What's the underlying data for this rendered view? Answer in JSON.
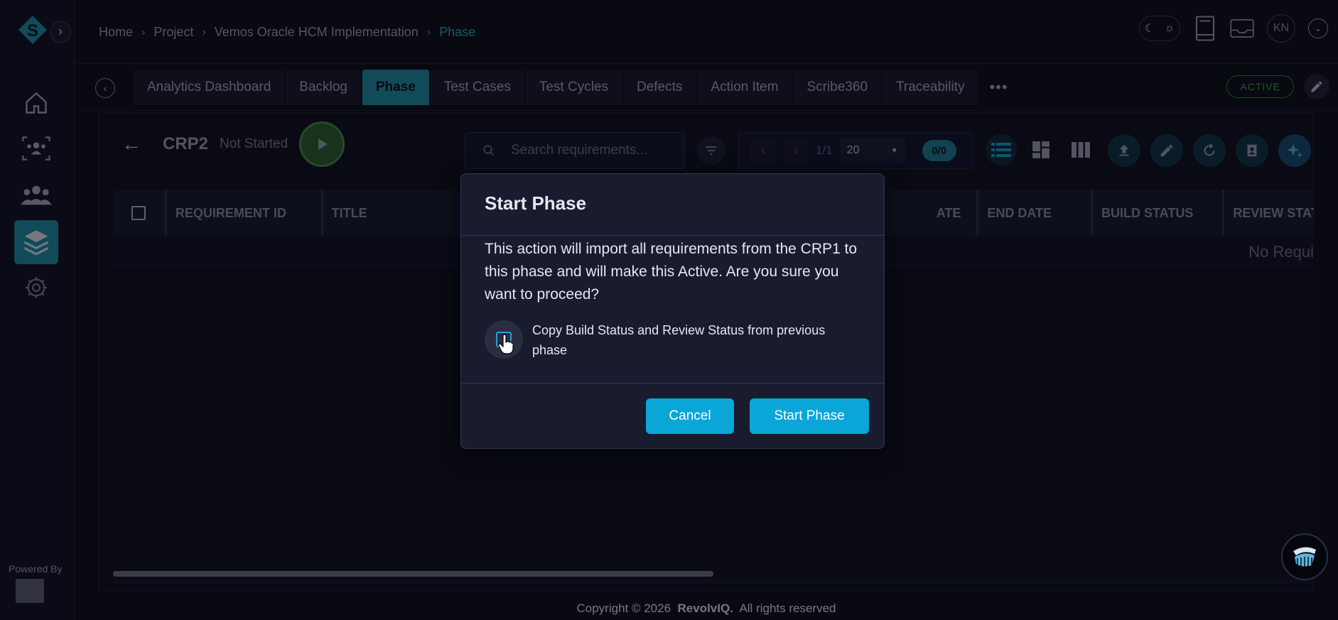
{
  "breadcrumb": {
    "home": "Home",
    "project": "Project",
    "implementation": "Vemos Oracle HCM Implementation",
    "current": "Phase"
  },
  "user": {
    "initials": "KN"
  },
  "tabs": [
    {
      "label": "Analytics Dashboard",
      "active": false
    },
    {
      "label": "Backlog",
      "active": false
    },
    {
      "label": "Phase",
      "active": true
    },
    {
      "label": "Test Cases",
      "active": false
    },
    {
      "label": "Test Cycles",
      "active": false
    },
    {
      "label": "Defects",
      "active": false
    },
    {
      "label": "Action Item",
      "active": false
    },
    {
      "label": "Scribe360",
      "active": false
    },
    {
      "label": "Traceability",
      "active": false
    }
  ],
  "more_label": "•••",
  "project_status": "ACTIVE",
  "phase": {
    "name": "CRP2",
    "status": "Not Started"
  },
  "search": {
    "placeholder": "Search requirements..."
  },
  "pagination": {
    "page": "1/1",
    "page_size": "20",
    "count": "0/0"
  },
  "table": {
    "headers": [
      "REQUIREMENT ID",
      "TITLE",
      "ATE",
      "END DATE",
      "BUILD STATUS",
      "REVIEW STATU"
    ],
    "empty_text": "No Requi"
  },
  "modal": {
    "title": "Start Phase",
    "body": "This action will import all requirements from the CRP1 to this phase and will make this Active. Are you sure you want to proceed?",
    "checkbox_label": "Copy Build Status and Review Status from previous phase",
    "cancel_label": "Cancel",
    "confirm_label": "Start Phase"
  },
  "sidebar": {
    "powered_by": "Powered By"
  },
  "footer": {
    "prefix": "Copyright © 2026",
    "brand": "RevolvIQ.",
    "suffix": "All rights reserved"
  },
  "colors": {
    "accent": "#1c8fa5",
    "primary_button": "#0aa6d8",
    "breadcrumb_active": "#27a9c9",
    "status_active": "#3aa84a"
  }
}
